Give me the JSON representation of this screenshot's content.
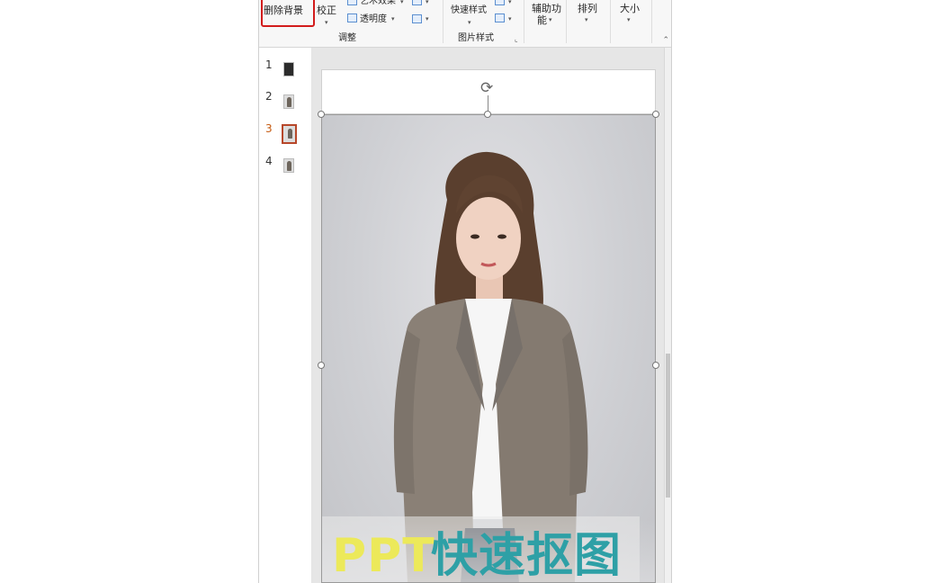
{
  "ribbon": {
    "remove_background": "删除背景",
    "corrections": "校正",
    "artistic_effects": "艺术效果",
    "transparency": "透明度",
    "adjust_group": "调整",
    "quick_styles": "快速样式",
    "picture_styles_group": "图片样式",
    "accessibility_line1": "辅助功",
    "accessibility_line2": "能",
    "arrange": "排列",
    "size": "大小"
  },
  "slides": [
    "1",
    "2",
    "3",
    "4"
  ],
  "active_slide": "3",
  "caption": {
    "part1": "PPT",
    "part2": "快速抠图"
  },
  "colors": {
    "highlight": "#d21c1c",
    "active_thumb": "#b7472a",
    "caption_yellow": "#ece95a",
    "caption_teal": "#2ea0a6"
  }
}
